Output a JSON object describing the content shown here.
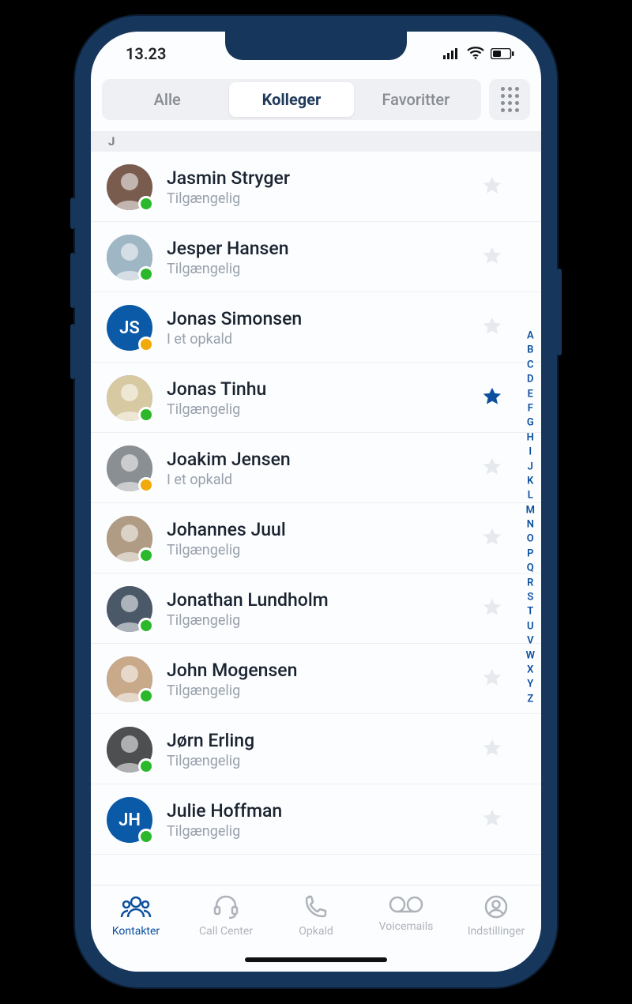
{
  "status_bar": {
    "time": "13.23"
  },
  "tabs": {
    "items": [
      "Alle",
      "Kolleger",
      "Favoritter"
    ],
    "active_index": 1
  },
  "section_letter": "J",
  "status_labels": {
    "available": "Tilgængelig",
    "on_call": "I et opkald"
  },
  "colors": {
    "accent": "#0b4f9e",
    "available": "#2bb82b",
    "on_call": "#f1a90c"
  },
  "contacts": [
    {
      "name": "Jasmin Stryger",
      "status": "available",
      "favorite": false,
      "avatar_type": "photo",
      "avatar_initials": "",
      "avatar_color": "#7a5c4f"
    },
    {
      "name": "Jesper Hansen",
      "status": "available",
      "favorite": false,
      "avatar_type": "photo",
      "avatar_initials": "",
      "avatar_color": "#9fb6c4"
    },
    {
      "name": "Jonas Simonsen",
      "status": "on_call",
      "favorite": false,
      "avatar_type": "initials",
      "avatar_initials": "JS",
      "avatar_color": "#0b5aa7"
    },
    {
      "name": "Jonas Tinhu",
      "status": "available",
      "favorite": true,
      "avatar_type": "photo",
      "avatar_initials": "",
      "avatar_color": "#d7c9a1"
    },
    {
      "name": "Joakim Jensen",
      "status": "on_call",
      "favorite": false,
      "avatar_type": "photo",
      "avatar_initials": "",
      "avatar_color": "#8a8f93"
    },
    {
      "name": "Johannes Juul",
      "status": "available",
      "favorite": false,
      "avatar_type": "photo",
      "avatar_initials": "",
      "avatar_color": "#b09b84"
    },
    {
      "name": "Jonathan Lundholm",
      "status": "available",
      "favorite": false,
      "avatar_type": "photo",
      "avatar_initials": "",
      "avatar_color": "#4a5868"
    },
    {
      "name": "John Mogensen",
      "status": "available",
      "favorite": false,
      "avatar_type": "photo",
      "avatar_initials": "",
      "avatar_color": "#c8a98a"
    },
    {
      "name": "Jørn Erling",
      "status": "available",
      "favorite": false,
      "avatar_type": "photo",
      "avatar_initials": "",
      "avatar_color": "#4d4f51"
    },
    {
      "name": "Julie Hoffman",
      "status": "available",
      "favorite": false,
      "avatar_type": "initials",
      "avatar_initials": "JH",
      "avatar_color": "#0b5aa7"
    }
  ],
  "alpha_index": [
    "A",
    "B",
    "C",
    "D",
    "E",
    "F",
    "G",
    "H",
    "I",
    "J",
    "K",
    "L",
    "M",
    "N",
    "O",
    "P",
    "Q",
    "R",
    "S",
    "T",
    "U",
    "V",
    "W",
    "X",
    "Y",
    "Z"
  ],
  "bottom_nav": {
    "items": [
      {
        "label": "Kontakter",
        "icon": "people-icon"
      },
      {
        "label": "Call Center",
        "icon": "headset-icon"
      },
      {
        "label": "Opkald",
        "icon": "phone-icon"
      },
      {
        "label": "Voicemails",
        "icon": "voicemail-icon"
      },
      {
        "label": "Indstillinger",
        "icon": "user-circle-icon"
      }
    ],
    "active_index": 0
  }
}
